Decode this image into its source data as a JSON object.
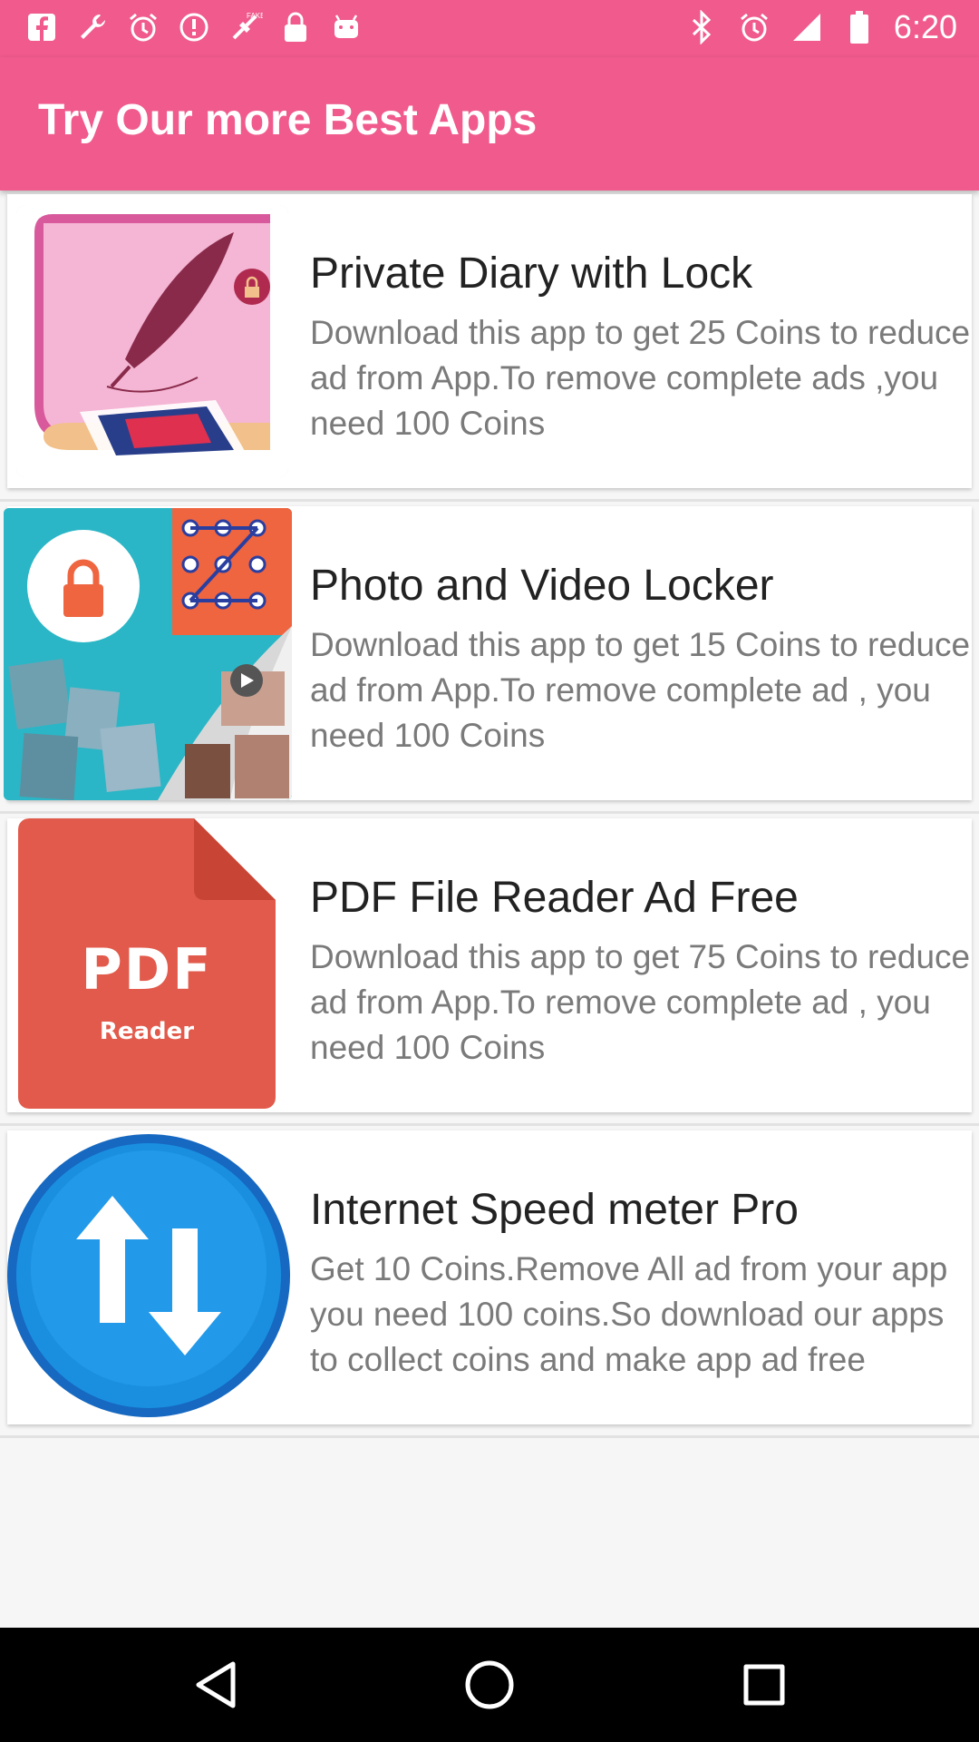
{
  "status_bar": {
    "time": "6:20",
    "left_icons": [
      "facebook-icon",
      "wrench-icon",
      "alarm-icon",
      "clock-alert-icon",
      "fake-gps-icon",
      "lock-icon",
      "android-icon"
    ],
    "right_icons": [
      "bluetooth-icon",
      "alarm-icon",
      "signal-icon",
      "battery-icon"
    ]
  },
  "app_bar": {
    "title": "Try Our more Best Apps"
  },
  "apps": [
    {
      "title": "Private Diary with Lock",
      "description": "Download this app to get 25 Coins to reduce ad from App.To remove complete ads ,you need 100 Coins",
      "icon": "diary-icon"
    },
    {
      "title": "Photo and Video Locker",
      "description": "Download this app to get 15 Coins to reduce ad from App.To remove complete ad , you need 100 Coins",
      "icon": "photo-locker-icon"
    },
    {
      "title": "PDF File Reader Ad Free",
      "description": "Download this app to get 75 Coins to reduce ad from App.To remove complete ad , you need 100 Coins",
      "icon": "pdf-reader-icon",
      "icon_text": {
        "big": "PDF",
        "small": "Reader"
      }
    },
    {
      "title": "Internet Speed meter Pro",
      "description": "Get 10 Coins.Remove All ad from your app you need 100 coins.So download our apps to collect coins and make app ad free",
      "icon": "speed-meter-icon"
    }
  ],
  "nav_bar": {
    "buttons": [
      "back-icon",
      "home-icon",
      "recents-icon"
    ]
  },
  "colors": {
    "accent": "#f05a8d",
    "pdf": "#e25a4b",
    "speed": "#1a8fe0"
  }
}
